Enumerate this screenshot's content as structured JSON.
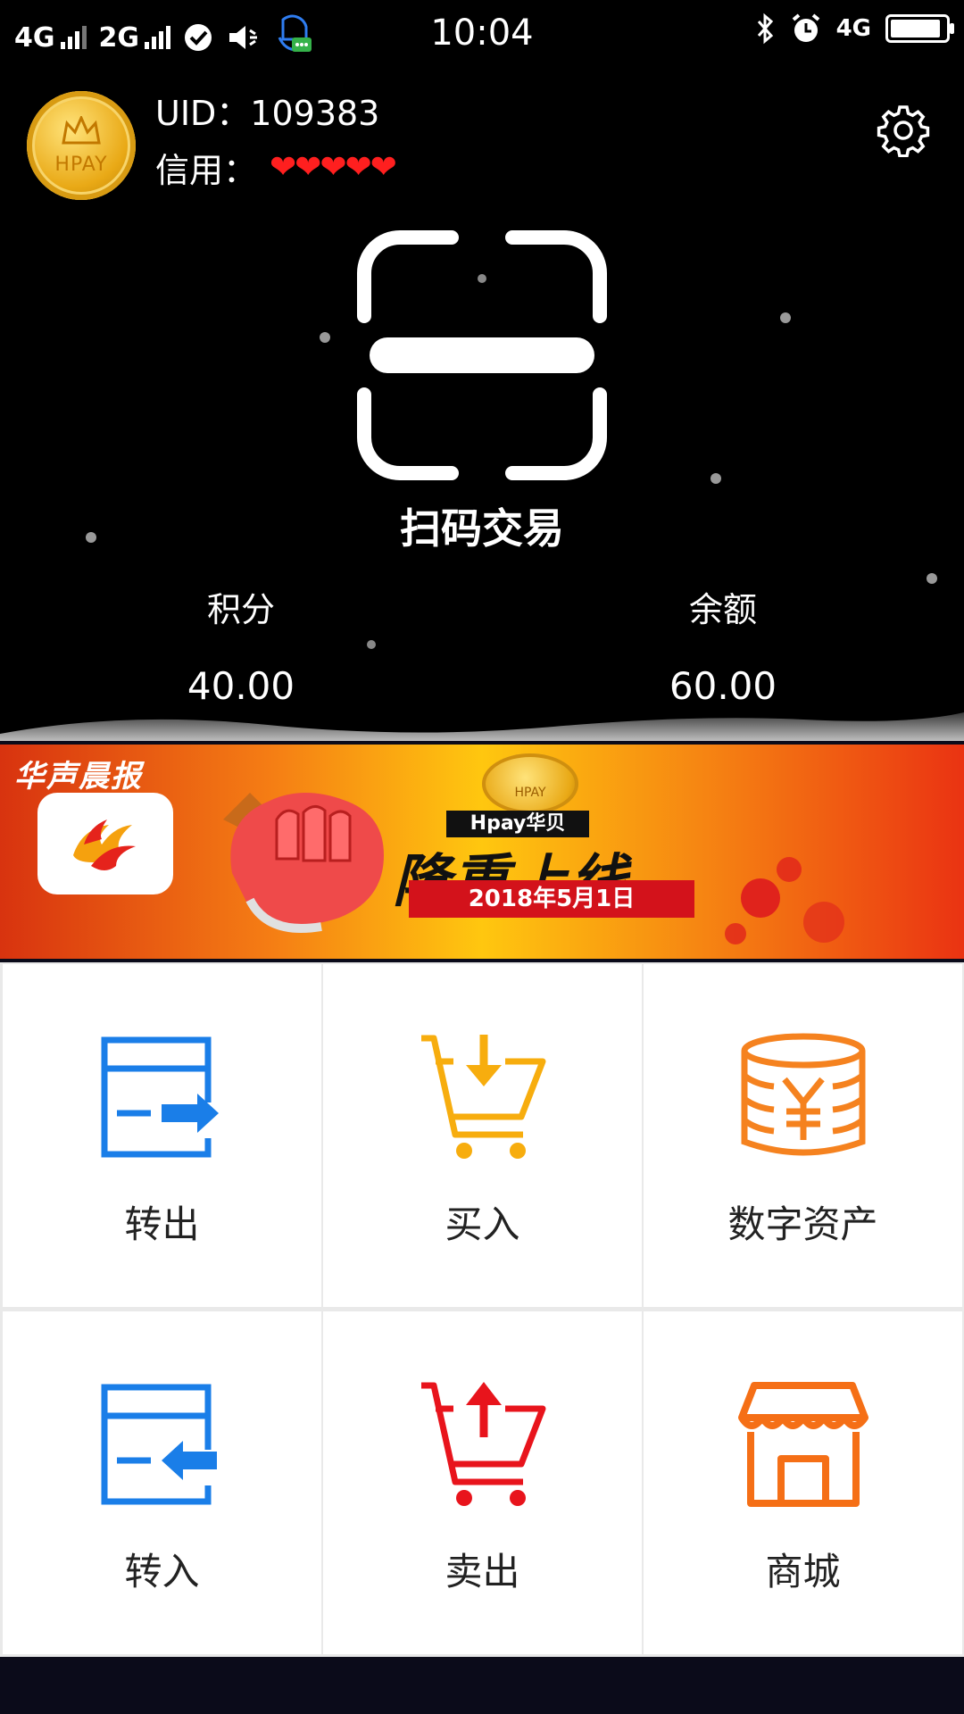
{
  "status_bar": {
    "network_1": "4G",
    "network_2": "2G",
    "time": "10:04",
    "network_right": "4G",
    "battery_fraction": 0.92
  },
  "profile": {
    "avatar_brand": "HPAY",
    "uid_label": "UID：",
    "uid_value": "109383",
    "credit_label": "信用：",
    "credit_hearts": "❤❤❤❤❤",
    "credit_rating": 5
  },
  "scan": {
    "title": "扫码交易"
  },
  "stats": {
    "points_label": "积分",
    "points_value": "40.00",
    "balance_label": "余额",
    "balance_value": "60.00"
  },
  "banner": {
    "news_title": "华声晨报",
    "coin_brand": "HPAY",
    "product": "Hpay华贝",
    "headline": "隆重上线",
    "date": "2018年5月1日"
  },
  "menu": [
    {
      "label": "转出",
      "icon": "transfer-out-icon",
      "color": "#1a7ee8"
    },
    {
      "label": "买入",
      "icon": "cart-buy-icon",
      "color": "#f7ad0e"
    },
    {
      "label": "数字资产",
      "icon": "coin-stack-icon",
      "color": "#f5821f"
    },
    {
      "label": "转入",
      "icon": "transfer-in-icon",
      "color": "#1a7ee8"
    },
    {
      "label": "卖出",
      "icon": "cart-sell-icon",
      "color": "#e8141c"
    },
    {
      "label": "商城",
      "icon": "store-icon",
      "color": "#f56f16"
    }
  ]
}
